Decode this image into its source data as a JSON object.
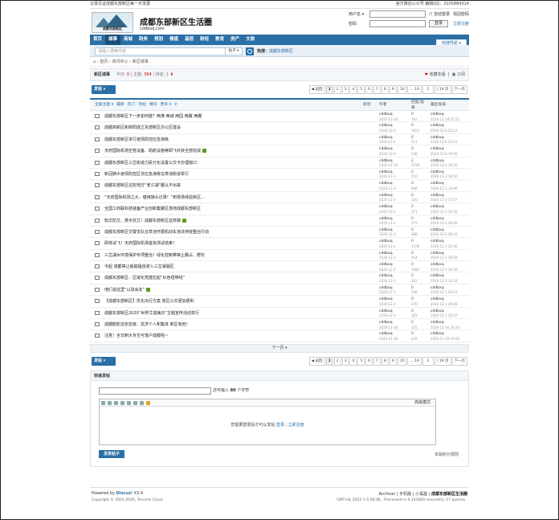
{
  "topbar": {
    "left": "记录见证成都东部新区每一天发展",
    "right": "官方微信公众号   编辑QQ：3105884314"
  },
  "header": {
    "logo_text": "成都东部新区",
    "site_title": "成都东部新区生活圈",
    "site_url": "cddbxq.com"
  },
  "login": {
    "user_label": "用户名 ▾",
    "pass_label": "密码",
    "auto_login": "自动登录",
    "find_pass": "找回密码",
    "login_btn": "登录",
    "register": "立即注册"
  },
  "nav": {
    "items": [
      "首页",
      "城事",
      "商城",
      "政务",
      "规划",
      "楼盘",
      "基层",
      "财经",
      "教育",
      "房产",
      "文旅"
    ],
    "active_index": 1,
    "quick": "快捷导航 ▾"
  },
  "search": {
    "placeholder": "请输入搜索内容",
    "type": "帖子 ▾",
    "hot_label": "热搜：",
    "hot_item": "成都东部新区"
  },
  "breadcrumb": "⌂  ›  首页  ›  资讯中心  ›  新区城事",
  "forum": {
    "name": "新区城事",
    "today_label": "今日:",
    "today": "0",
    "topics_label": "主题:",
    "topics": "364",
    "rank_label": "排名:",
    "rank": "1",
    "favorite": "收藏本版",
    "subscribe": "订阅"
  },
  "toolbar": {
    "post_btn": "发帖 ▾",
    "prev": "◀ 返回",
    "pages": [
      "1",
      "2",
      "3",
      "4",
      "5",
      "6",
      "7",
      "8",
      "9",
      "10",
      "... 19"
    ],
    "page_input": "1",
    "page_total": "/ 19 页",
    "next": "下一页"
  },
  "list_head": {
    "filters": [
      "全部主题 ▾",
      "最新",
      "热门",
      "热帖",
      "精华",
      "更多 ▾"
    ],
    "new": "新窗",
    "author": "作者",
    "reply": "回复/查看",
    "last": "最后发表"
  },
  "threads": [
    {
      "title": "成都东部新区下一步如何建？两港 两城 两园 两翼 两翼",
      "img": false,
      "author": "cddbxq",
      "date": "2020-12-29",
      "replies": "0",
      "views": "781",
      "last": "cddbxq",
      "ldate": "2020-12-29 15:52"
    },
    {
      "title": "成都高新区和简阳成立东部新区办公区建设",
      "img": false,
      "author": "cddbxq",
      "date": "2020-12-6",
      "replies": "0",
      "views": "1923",
      "last": "cddbxq",
      "ldate": "2020-12-6 20:12"
    },
    {
      "title": "成都东部新区举行疫情防控应急演练",
      "img": false,
      "author": "cddbxq",
      "date": "2020-12-6",
      "replies": "0",
      "views": "511",
      "last": "cddbxq",
      "ldate": "2020-12-6 20:12"
    },
    {
      "title": "天府国际机场空管设备、助航设施等即飞并获全部完成",
      "img": true,
      "author": "cddbxq",
      "date": "2020-12-6",
      "replies": "0",
      "views": "546",
      "last": "cddbxq",
      "ldate": "2020-12-6 19:56"
    },
    {
      "title": "成都东部新区三岔街道力民分化设置公交卡办理窗口",
      "img": false,
      "author": "cddbxq",
      "date": "2020-11-30",
      "replies": "2",
      "views": "2799",
      "last": "cddbxq",
      "ldate": "2020-12-6 16:55"
    },
    {
      "title": "新冠肺炎疫情防控区非应急演练在草池街道举行",
      "img": false,
      "author": "cddbxq",
      "date": "2020-12-3",
      "replies": "0",
      "views": "210",
      "last": "cddbxq",
      "ldate": "2020-12-3 19:50"
    },
    {
      "title": "成都东部新区这些地方“老江湖”都认不出来",
      "img": false,
      "author": "cddbxq",
      "date": "2020-12-3",
      "replies": "0",
      "views": "636",
      "last": "cddbxq",
      "ldate": "2020-12-3 19:46"
    },
    {
      "title": "“天府国际机场之大，堪用接头记录！”到现场体验新区…",
      "img": false,
      "author": "cddbxq",
      "date": "2020-12-3",
      "replies": "0",
      "views": "320",
      "last": "cddbxq",
      "ldate": "2020-12-3 12:07"
    },
    {
      "title": "全国工商联科技装备产业创新集聚区落地成都东部新区",
      "img": false,
      "author": "cddbxq",
      "date": "2020-12-2",
      "replies": "0",
      "views": "371",
      "last": "cddbxq",
      "ldate": "2020-12-2 20:26"
    },
    {
      "title": "知文防艾，携手抗艾！成都东部新区这样做",
      "img": true,
      "author": "cddbxq",
      "date": "2020-12-2",
      "replies": "0",
      "views": "275",
      "last": "cddbxq",
      "ldate": "2020-12-2 08:46"
    },
    {
      "title": "成都东部新区交警支队在草池开展机动车违法停放整治行动",
      "img": false,
      "author": "cddbxq",
      "date": "2020-12-2",
      "replies": "0",
      "views": "388",
      "last": "cddbxq",
      "ldate": "2020-12-2 08:42"
    },
    {
      "title": "即将试飞！天府国际机场首批测试结束！",
      "img": false,
      "author": "cddbxq",
      "date": "2020-12-1",
      "replies": "0",
      "views": "1198",
      "last": "cddbxq",
      "ldate": "2020-12-1 21:00"
    },
    {
      "title": "三岔湖水环境保护专项整治！绿化控制带禁止霸占、野炊",
      "img": false,
      "author": "cddbxq",
      "date": "2020-12-1",
      "replies": "0",
      "views": "914",
      "last": "cddbxq",
      "ldate": "2020-12-1 20:58"
    },
    {
      "title": "今起 成都禁止船舶擅自驶入三岔湖湖区",
      "img": false,
      "author": "cddbxq",
      "date": "2020-12-1",
      "replies": "0",
      "views": "1982",
      "last": "cddbxq",
      "ldate": "2020-12-1 20:56"
    },
    {
      "title": "成都东部新区：区域化党建拉起“红色纽带线”",
      "img": false,
      "author": "cddbxq",
      "date": "2020-12-1",
      "replies": "0",
      "views": "281",
      "last": "cddbxq",
      "ldate": "2020-12-1 20:54"
    },
    {
      "title": "他们说这里“以球会友”",
      "img": true,
      "author": "cddbxq",
      "date": "2020-12-1",
      "replies": "0",
      "views": "546",
      "last": "cddbxq",
      "ldate": "2020-12-1 20:51"
    },
    {
      "title": "【成都东部新区】优化出行方案 景区公交更加便利",
      "img": false,
      "author": "cddbxq",
      "date": "2020-12-1",
      "replies": "0",
      "views": "370",
      "last": "cddbxq",
      "ldate": "2020-12-1 20:48"
    },
    {
      "title": "成都东部新区2020“世界艾滋病日”主题宣传活动举行",
      "img": false,
      "author": "cddbxq",
      "date": "2020-12-1",
      "replies": "0",
      "views": "283",
      "last": "cddbxq",
      "ldate": "2020-12-1 20:47"
    },
    {
      "title": "成都鹤影这些抗疫、抗洪个人和集体 新区有他！",
      "img": false,
      "author": "cddbxq",
      "date": "2020-11-30",
      "replies": "0",
      "views": "325",
      "last": "cddbxq",
      "ldate": "2020-11-30 20:24"
    },
    {
      "title": "注意！全日制大专生可落户成都啦~",
      "img": false,
      "author": "cddbxq",
      "date": "2020-11-30",
      "replies": "0",
      "views": "429",
      "last": "cddbxq",
      "ldate": "2020-11-30 19:06"
    }
  ],
  "next_page": "下一页 ▾",
  "quick_post": {
    "title": "快速发帖",
    "hint_pre": "还可输入",
    "hint_num": "80",
    "hint_post": "个字符",
    "mode": "高级模式",
    "need_login": "您需要登录后才可以发帖",
    "login": "登录",
    "sep": "|",
    "register": "立即注册",
    "submit": "发表帖子",
    "rule": "本版积分规则"
  },
  "footer": {
    "powered": "Powered by ",
    "discuz": "Discuz!",
    "ver": " X3.4",
    "copyright": "Copyright © 2001-2020, Tencent Cloud.",
    "links": "Archiver  |  手机版  |  小黑屋  |  ",
    "site": "成都东部新区生活圈",
    "gmt": "GMT+8, 2021-1-5 00:06 , Processed in 0.141600 second(s), 17 queries ."
  }
}
